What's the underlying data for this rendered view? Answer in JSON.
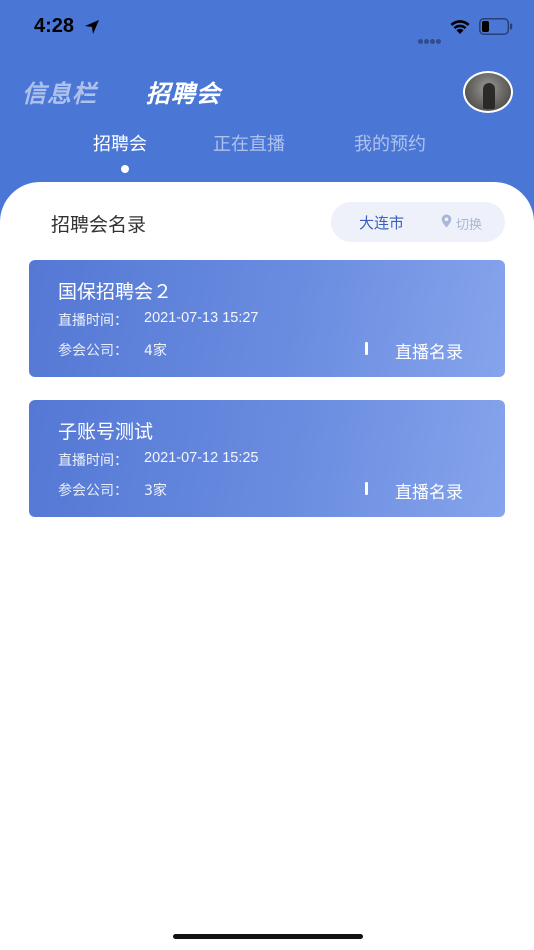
{
  "status_bar": {
    "time": "4:28"
  },
  "nav": {
    "title_left": "信息栏",
    "title_right": "招聘会"
  },
  "tabs": [
    {
      "label": "招聘会",
      "active": true
    },
    {
      "label": "正在直播",
      "active": false
    },
    {
      "label": "我的预约",
      "active": false
    }
  ],
  "section": {
    "title": "招聘会名录",
    "city": "大连市",
    "switch_label": "切换"
  },
  "fairs": [
    {
      "name": "国保招聘会２",
      "time_label": "直播时间：",
      "time_value": "2021-07-13 15:27",
      "company_label": "参会公司：",
      "company_value": "4家",
      "link_label": "直播名录"
    },
    {
      "name": "子账号测试",
      "time_label": "直播时间：",
      "time_value": "2021-07-12 15:25",
      "company_label": "参会公司：",
      "company_value": "3家",
      "link_label": "直播名录"
    }
  ],
  "colors": {
    "header_blue": "#4a76d6",
    "card_start": "#5478d4",
    "card_end": "#86a4ec",
    "city_text": "#3a5fbf"
  }
}
